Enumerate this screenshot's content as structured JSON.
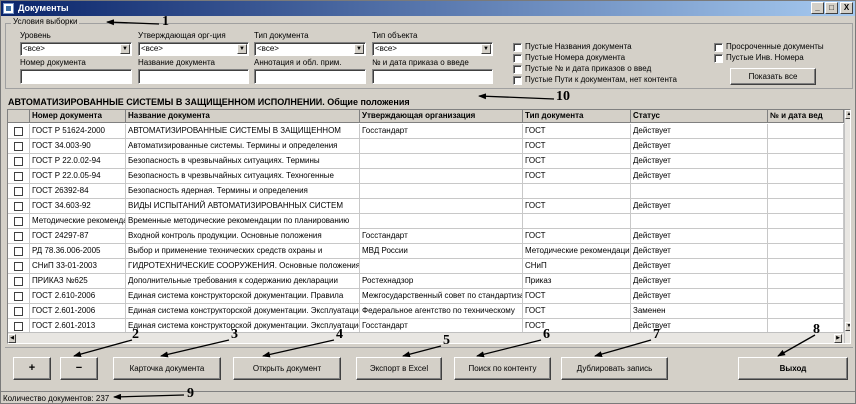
{
  "window": {
    "title": "Документы",
    "minimize": "_",
    "maximize": "□",
    "close": "X"
  },
  "filter_group": {
    "title": "Условия выборки",
    "level": {
      "label": "Уровень",
      "value": "<все>"
    },
    "approving_org": {
      "label": "Утверждающая орг-ция",
      "value": "<все>"
    },
    "doc_type": {
      "label": "Тип документа",
      "value": "<все>"
    },
    "object_type": {
      "label": "Тип объекта",
      "value": "<все>"
    },
    "doc_number": {
      "label": "Номер документа",
      "value": ""
    },
    "doc_name": {
      "label": "Название документа",
      "value": ""
    },
    "annotation": {
      "label": "Аннотация и обл. прим.",
      "value": ""
    },
    "order_number": {
      "label": "№ и дата приказа о введе",
      "value": ""
    },
    "checkboxes_left": [
      "Пустые Названия документа",
      "Пустые Номера документа",
      "Пустые № и дата приказов о введ",
      "Пустые Пути к документам, нет контента"
    ],
    "checkboxes_right": [
      "Просроченные документы",
      "Пустые Инв. Номера"
    ],
    "show_all_button": "Показать все"
  },
  "heading": "АВТОМАТИЗИРОВАННЫЕ СИСТЕМЫ В ЗАЩИЩЕННОМ ИСПОЛНЕНИИ. Общие положения",
  "table": {
    "columns": [
      "Номер документа",
      "Название документа",
      "Утверждающая организация",
      "Тип документа",
      "Статус",
      "№ и дата вед"
    ],
    "rows": [
      [
        "ГОСТ Р 51624-2000",
        "АВТОМАТИЗИРОВАННЫЕ СИСТЕМЫ В ЗАЩИЩЕННОМ",
        "Госстандарт",
        "ГОСТ",
        "Действует",
        ""
      ],
      [
        "ГОСТ 34.003-90",
        "Автоматизированные системы. Термины и определения",
        "",
        "ГОСТ",
        "Действует",
        ""
      ],
      [
        "ГОСТ Р 22.0.02-94",
        "Безопасность в чрезвычайных ситуациях. Термины",
        "",
        "ГОСТ",
        "Действует",
        ""
      ],
      [
        "ГОСТ Р 22.0.05-94",
        "Безопасность в чрезвычайных ситуациях. Техногенные",
        "",
        "ГОСТ",
        "Действует",
        ""
      ],
      [
        "ГОСТ 26392-84",
        "Безопасность ядерная. Термины и определения",
        "",
        "",
        "",
        ""
      ],
      [
        "ГОСТ 34.603-92",
        "ВИДЫ ИСПЫТАНИЙ АВТОМАТИЗИРОВАННЫХ СИСТЕМ",
        "",
        "ГОСТ",
        "Действует",
        ""
      ],
      [
        "Методические рекомендации",
        "Временные методические рекомендации по планированию",
        "",
        "",
        "",
        ""
      ],
      [
        "ГОСТ 24297-87",
        "Входной контроль продукции. Основные положения",
        "Госстандарт",
        "ГОСТ",
        "Действует",
        ""
      ],
      [
        "РД 78.36.006-2005",
        "Выбор и применение технических средств охраны и",
        "МВД России",
        "Методические рекомендации",
        "Действует",
        ""
      ],
      [
        "СНиП 33-01-2003",
        "ГИДРОТЕХНИЧЕСКИЕ СООРУЖЕНИЯ. Основные положения",
        "",
        "СНиП",
        "Действует",
        ""
      ],
      [
        "ПРИКАЗ №625",
        "Дополнительные требования к содержанию декларации",
        "Ростехнадзор",
        "Приказ",
        "Действует",
        ""
      ],
      [
        "ГОСТ 2.610-2006",
        "Единая система конструкторской документации. Правила",
        "Межгосударственный совет по стандартизации",
        "ГОСТ",
        "Действует",
        ""
      ],
      [
        "ГОСТ 2.601-2006",
        "Единая система конструкторской документации. Эксплуатационные",
        "Федеральное агентство по техническому",
        "ГОСТ",
        "Заменен",
        ""
      ],
      [
        "ГОСТ 2.601-2013",
        "Единая система конструкторской документации. Эксплуатационные",
        "Госстандарт",
        "ГОСТ",
        "Действует",
        ""
      ]
    ]
  },
  "buttons": {
    "add": "+",
    "remove": "−",
    "card": "Карточка документа",
    "open": "Открыть документ",
    "export": "Экспорт в Excel",
    "search": "Поиск по контенту",
    "duplicate": "Дублировать запись",
    "exit": "Выход"
  },
  "status": {
    "text": "Количество документов: 237"
  },
  "annotations": [
    "1",
    "2",
    "3",
    "4",
    "5",
    "6",
    "7",
    "8",
    "9",
    "10"
  ]
}
